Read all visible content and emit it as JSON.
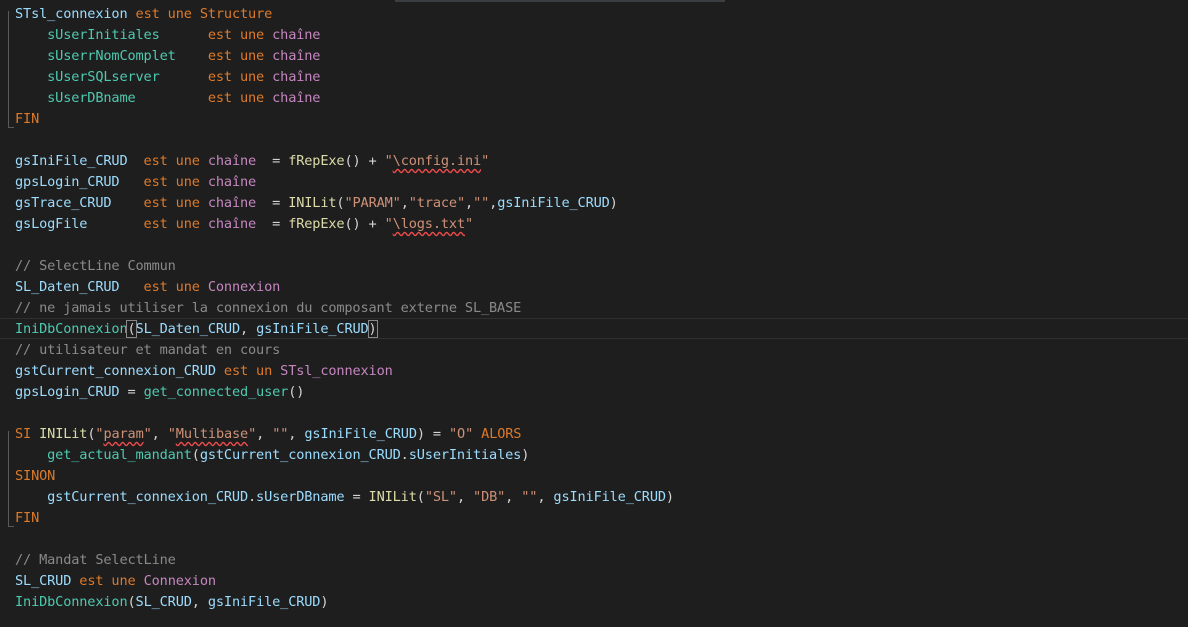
{
  "editor": {
    "lines": [
      {
        "tokens": [
          {
            "t": "STsl_connexion",
            "c": "t-id"
          },
          {
            "t": " ",
            "c": "t-op"
          },
          {
            "t": "est une",
            "c": "t-kw2"
          },
          {
            "t": " ",
            "c": "t-op"
          },
          {
            "t": "Structure",
            "c": "t-kw2"
          }
        ]
      },
      {
        "tokens": [
          {
            "t": "    sUserInitiales      ",
            "c": "t-fld"
          },
          {
            "t": "est une",
            "c": "t-kw2"
          },
          {
            "t": " ",
            "c": "t-op"
          },
          {
            "t": "chaîne",
            "c": "t-type"
          }
        ]
      },
      {
        "tokens": [
          {
            "t": "    sUserrNomComplet    ",
            "c": "t-fld"
          },
          {
            "t": "est une",
            "c": "t-kw2"
          },
          {
            "t": " ",
            "c": "t-op"
          },
          {
            "t": "chaîne",
            "c": "t-type"
          }
        ]
      },
      {
        "tokens": [
          {
            "t": "    sUserSQLserver      ",
            "c": "t-fld"
          },
          {
            "t": "est une",
            "c": "t-kw2"
          },
          {
            "t": " ",
            "c": "t-op"
          },
          {
            "t": "chaîne",
            "c": "t-type"
          }
        ]
      },
      {
        "tokens": [
          {
            "t": "    sUserDBname         ",
            "c": "t-fld"
          },
          {
            "t": "est une",
            "c": "t-kw2"
          },
          {
            "t": " ",
            "c": "t-op"
          },
          {
            "t": "chaîne",
            "c": "t-type"
          }
        ]
      },
      {
        "tokens": [
          {
            "t": "FIN",
            "c": "t-kw2"
          }
        ]
      },
      {
        "tokens": []
      },
      {
        "tokens": [
          {
            "t": "gsIniFile_CRUD  ",
            "c": "t-id"
          },
          {
            "t": "est une",
            "c": "t-kw2"
          },
          {
            "t": " ",
            "c": "t-op"
          },
          {
            "t": "chaîne",
            "c": "t-type"
          },
          {
            "t": "  = ",
            "c": "t-op"
          },
          {
            "t": "fRepExe",
            "c": "t-fnb"
          },
          {
            "t": "() + ",
            "c": "t-op"
          },
          {
            "t": "\"",
            "c": "t-str"
          },
          {
            "t": "\\config.ini",
            "c": "t-str sq"
          },
          {
            "t": "\"",
            "c": "t-str"
          }
        ]
      },
      {
        "tokens": [
          {
            "t": "gpsLogin_CRUD   ",
            "c": "t-id"
          },
          {
            "t": "est une",
            "c": "t-kw2"
          },
          {
            "t": " ",
            "c": "t-op"
          },
          {
            "t": "chaîne",
            "c": "t-type"
          }
        ]
      },
      {
        "tokens": [
          {
            "t": "gsTrace_CRUD    ",
            "c": "t-id"
          },
          {
            "t": "est une",
            "c": "t-kw2"
          },
          {
            "t": " ",
            "c": "t-op"
          },
          {
            "t": "chaîne",
            "c": "t-type"
          },
          {
            "t": "  = ",
            "c": "t-op"
          },
          {
            "t": "INILit",
            "c": "t-fnb"
          },
          {
            "t": "(",
            "c": "t-op"
          },
          {
            "t": "\"PARAM\"",
            "c": "t-str"
          },
          {
            "t": ",",
            "c": "t-op"
          },
          {
            "t": "\"trace\"",
            "c": "t-str"
          },
          {
            "t": ",",
            "c": "t-op"
          },
          {
            "t": "\"\"",
            "c": "t-str"
          },
          {
            "t": ",",
            "c": "t-op"
          },
          {
            "t": "gsIniFile_CRUD",
            "c": "t-id"
          },
          {
            "t": ")",
            "c": "t-op"
          }
        ]
      },
      {
        "tokens": [
          {
            "t": "gsLogFile       ",
            "c": "t-id"
          },
          {
            "t": "est une",
            "c": "t-kw2"
          },
          {
            "t": " ",
            "c": "t-op"
          },
          {
            "t": "chaîne",
            "c": "t-type"
          },
          {
            "t": "  = ",
            "c": "t-op"
          },
          {
            "t": "fRepExe",
            "c": "t-fnb"
          },
          {
            "t": "() + ",
            "c": "t-op"
          },
          {
            "t": "\"",
            "c": "t-str"
          },
          {
            "t": "\\logs.txt",
            "c": "t-str sq"
          },
          {
            "t": "\"",
            "c": "t-str"
          }
        ]
      },
      {
        "tokens": []
      },
      {
        "tokens": [
          {
            "t": "// SelectLine Commun",
            "c": "t-cm"
          }
        ]
      },
      {
        "tokens": [
          {
            "t": "SL_Daten_CRUD   ",
            "c": "t-id"
          },
          {
            "t": "est une",
            "c": "t-kw2"
          },
          {
            "t": " ",
            "c": "t-op"
          },
          {
            "t": "Connexion",
            "c": "t-type"
          }
        ]
      },
      {
        "tokens": [
          {
            "t": "// ne jamais utiliser la connexion du composant externe SL_BASE",
            "c": "t-cm"
          }
        ]
      },
      {
        "tokens": [
          {
            "t": "IniDbConnexion",
            "c": "t-fn"
          },
          {
            "t": "(",
            "c": "t-op brk"
          },
          {
            "t": "SL_Daten_CRUD",
            "c": "t-id"
          },
          {
            "t": ", ",
            "c": "t-op"
          },
          {
            "t": "gsIniFile_CRUD",
            "c": "t-id"
          },
          {
            "t": ")",
            "c": "t-op brk"
          }
        ]
      },
      {
        "tokens": [
          {
            "t": "// utilisateur et mandat en cours",
            "c": "t-cm"
          }
        ]
      },
      {
        "tokens": [
          {
            "t": "gstCurrent_connexion_CRUD",
            "c": "t-id"
          },
          {
            "t": " ",
            "c": "t-op"
          },
          {
            "t": "est un",
            "c": "t-kw2"
          },
          {
            "t": " ",
            "c": "t-op"
          },
          {
            "t": "STsl_connexion",
            "c": "t-type"
          }
        ]
      },
      {
        "tokens": [
          {
            "t": "gpsLogin_CRUD",
            "c": "t-id"
          },
          {
            "t": " = ",
            "c": "t-op"
          },
          {
            "t": "get_connected_user",
            "c": "t-fn"
          },
          {
            "t": "()",
            "c": "t-op"
          }
        ]
      },
      {
        "tokens": []
      },
      {
        "tokens": [
          {
            "t": "SI",
            "c": "t-kw2"
          },
          {
            "t": " ",
            "c": "t-op"
          },
          {
            "t": "INILit",
            "c": "t-fnb"
          },
          {
            "t": "(",
            "c": "t-op"
          },
          {
            "t": "\"",
            "c": "t-str"
          },
          {
            "t": "param",
            "c": "t-str sq"
          },
          {
            "t": "\"",
            "c": "t-str"
          },
          {
            "t": ", ",
            "c": "t-op"
          },
          {
            "t": "\"",
            "c": "t-str"
          },
          {
            "t": "Multibase",
            "c": "t-str sq"
          },
          {
            "t": "\"",
            "c": "t-str"
          },
          {
            "t": ", ",
            "c": "t-op"
          },
          {
            "t": "\"\"",
            "c": "t-str"
          },
          {
            "t": ", ",
            "c": "t-op"
          },
          {
            "t": "gsIniFile_CRUD",
            "c": "t-id"
          },
          {
            "t": ") = ",
            "c": "t-op"
          },
          {
            "t": "\"O\"",
            "c": "t-str"
          },
          {
            "t": " ",
            "c": "t-op"
          },
          {
            "t": "ALORS",
            "c": "t-kw2"
          }
        ]
      },
      {
        "tokens": [
          {
            "t": "    ",
            "c": "t-op"
          },
          {
            "t": "get_actual_mandant",
            "c": "t-fn"
          },
          {
            "t": "(",
            "c": "t-op"
          },
          {
            "t": "gstCurrent_connexion_CRUD",
            "c": "t-id"
          },
          {
            "t": ".",
            "c": "t-op"
          },
          {
            "t": "sUserInitiales",
            "c": "t-id"
          },
          {
            "t": ")",
            "c": "t-op"
          }
        ]
      },
      {
        "tokens": [
          {
            "t": "SINON",
            "c": "t-kw2"
          }
        ]
      },
      {
        "tokens": [
          {
            "t": "    ",
            "c": "t-op"
          },
          {
            "t": "gstCurrent_connexion_CRUD",
            "c": "t-id"
          },
          {
            "t": ".",
            "c": "t-op"
          },
          {
            "t": "sUserDBname",
            "c": "t-id"
          },
          {
            "t": " = ",
            "c": "t-op"
          },
          {
            "t": "INILit",
            "c": "t-fnb"
          },
          {
            "t": "(",
            "c": "t-op"
          },
          {
            "t": "\"SL\"",
            "c": "t-str"
          },
          {
            "t": ", ",
            "c": "t-op"
          },
          {
            "t": "\"DB\"",
            "c": "t-str"
          },
          {
            "t": ", ",
            "c": "t-op"
          },
          {
            "t": "\"\"",
            "c": "t-str"
          },
          {
            "t": ", ",
            "c": "t-op"
          },
          {
            "t": "gsIniFile_CRUD",
            "c": "t-id"
          },
          {
            "t": ")",
            "c": "t-op"
          }
        ]
      },
      {
        "tokens": [
          {
            "t": "FIN",
            "c": "t-kw2"
          }
        ]
      },
      {
        "tokens": []
      },
      {
        "tokens": [
          {
            "t": "// Mandat SelectLine",
            "c": "t-cm"
          }
        ]
      },
      {
        "tokens": [
          {
            "t": "SL_CRUD",
            "c": "t-id"
          },
          {
            "t": " ",
            "c": "t-op"
          },
          {
            "t": "est une",
            "c": "t-kw2"
          },
          {
            "t": " ",
            "c": "t-op"
          },
          {
            "t": "Connexion",
            "c": "t-type"
          }
        ]
      },
      {
        "tokens": [
          {
            "t": "IniDbConnexion",
            "c": "t-fn"
          },
          {
            "t": "(",
            "c": "t-op"
          },
          {
            "t": "SL_CRUD",
            "c": "t-id"
          },
          {
            "t": ", ",
            "c": "t-op"
          },
          {
            "t": "gsIniFile_CRUD",
            "c": "t-id"
          },
          {
            "t": ")",
            "c": "t-op"
          }
        ]
      }
    ]
  }
}
